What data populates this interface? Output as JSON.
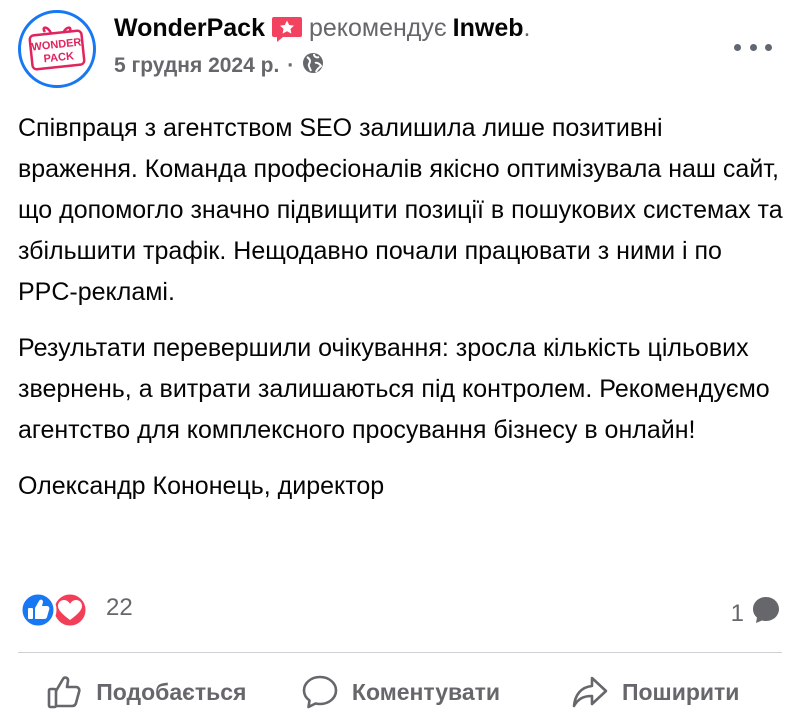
{
  "post": {
    "author": "WonderPack",
    "recommends_text": "рекомендує",
    "target": "Inweb",
    "period": ".",
    "date": "5 грудня 2024 р.",
    "separator": "·",
    "avatar_text_top": "WONDER",
    "avatar_text_bottom": "PACK",
    "paragraphs": [
      "Співпраця з агентством SEO залишила лише позитивні враження. Команда професіоналів якісно оптимізувала наш сайт, що допомогло значно підвищити позиції в пошукових системах та збільшити трафік. Нещодавно почали працювати з ними і по PPC-рекламі.",
      "Результати перевершили очікування: зросла кількість цільових звернень, а витрати залишаються під контролем. Рекомендуємо агентство для комплексного просування бізнесу в онлайн!",
      "Олександр Кононець, директор"
    ]
  },
  "stats": {
    "reactions_count": "22",
    "comments_count": "1"
  },
  "actions": {
    "like": "Подобається",
    "comment": "Коментувати",
    "share": "Поширити"
  },
  "colors": {
    "accent": "#1877f2",
    "badge": "#f02849",
    "secondary_text": "#65676b"
  },
  "icons": {
    "recommend_badge": "recommend-star-badge-icon",
    "privacy": "globe-icon",
    "more": "more-options-icon",
    "like_reaction": "like-reaction-icon",
    "love_reaction": "love-reaction-icon",
    "comment_bubble": "comment-bubble-icon",
    "like_action": "thumbs-up-icon",
    "comment_action": "comment-icon",
    "share_action": "share-arrow-icon"
  }
}
